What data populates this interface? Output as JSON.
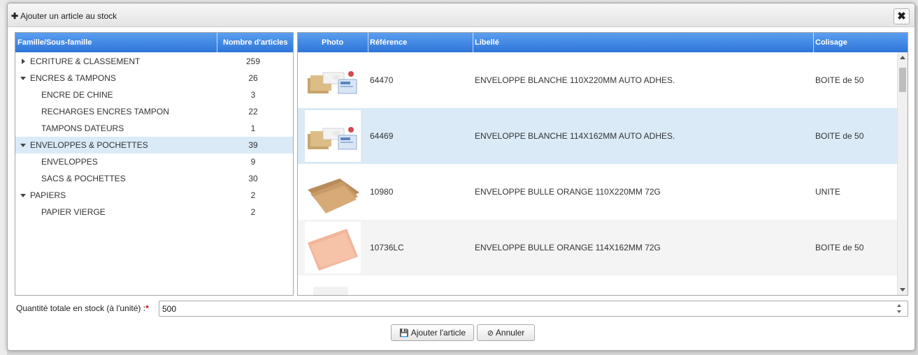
{
  "dialog": {
    "title": "Ajouter un article au stock",
    "title_icon": "plus-icon",
    "close_icon": "close-icon"
  },
  "families_table": {
    "headers": {
      "family": "Famille/Sous-famille",
      "count": "Nombre d'articles"
    },
    "rows": [
      {
        "label": "ECRITURE & CLASSEMENT",
        "count": "259",
        "level": 0,
        "expanded": false,
        "selected": false
      },
      {
        "label": "ENCRES & TAMPONS",
        "count": "26",
        "level": 0,
        "expanded": true,
        "selected": false
      },
      {
        "label": "ENCRE DE CHINE",
        "count": "3",
        "level": 1,
        "selected": false
      },
      {
        "label": "RECHARGES ENCRES TAMPON",
        "count": "22",
        "level": 1,
        "selected": false
      },
      {
        "label": "TAMPONS DATEURS",
        "count": "1",
        "level": 1,
        "selected": false
      },
      {
        "label": "ENVELOPPES & POCHETTES",
        "count": "39",
        "level": 0,
        "expanded": true,
        "selected": true
      },
      {
        "label": "ENVELOPPES",
        "count": "9",
        "level": 1,
        "selected": false
      },
      {
        "label": "SACS & POCHETTES",
        "count": "30",
        "level": 1,
        "selected": false
      },
      {
        "label": "PAPIERS",
        "count": "2",
        "level": 0,
        "expanded": true,
        "selected": false
      },
      {
        "label": "PAPIER VIERGE",
        "count": "2",
        "level": 1,
        "selected": false
      }
    ]
  },
  "articles_table": {
    "headers": {
      "photo": "Photo",
      "reference": "Référence",
      "label": "Libellé",
      "packaging": "Colisage"
    },
    "rows": [
      {
        "reference": "64470",
        "label": "ENVELOPPE BLANCHE 110X220MM AUTO ADHES.",
        "packaging": "BOITE de 50",
        "photo": "envelope-pack-image",
        "selected": false
      },
      {
        "reference": "64469",
        "label": "ENVELOPPE BLANCHE 114X162MM AUTO ADHES.",
        "packaging": "BOITE de 50",
        "photo": "envelope-pack-image",
        "selected": true
      },
      {
        "reference": "10980",
        "label": "ENVELOPPE BULLE ORANGE 110X220MM 72G",
        "packaging": "UNITE",
        "photo": "kraft-envelope-image",
        "selected": false
      },
      {
        "reference": "10736LC",
        "label": "ENVELOPPE BULLE ORANGE 114X162MM 72G",
        "packaging": "BOITE de 50",
        "photo": "orange-envelope-image",
        "selected": false
      }
    ]
  },
  "quantity": {
    "label": "Quantité totale en stock (à l'unité) :",
    "required_mark": "*",
    "value": "500"
  },
  "buttons": {
    "add": "Ajouter l'article",
    "cancel": "Annuler"
  },
  "colors": {
    "header_blue": "#3b82e0",
    "selected_row": "#daeaf7",
    "required": "#dd0000"
  }
}
